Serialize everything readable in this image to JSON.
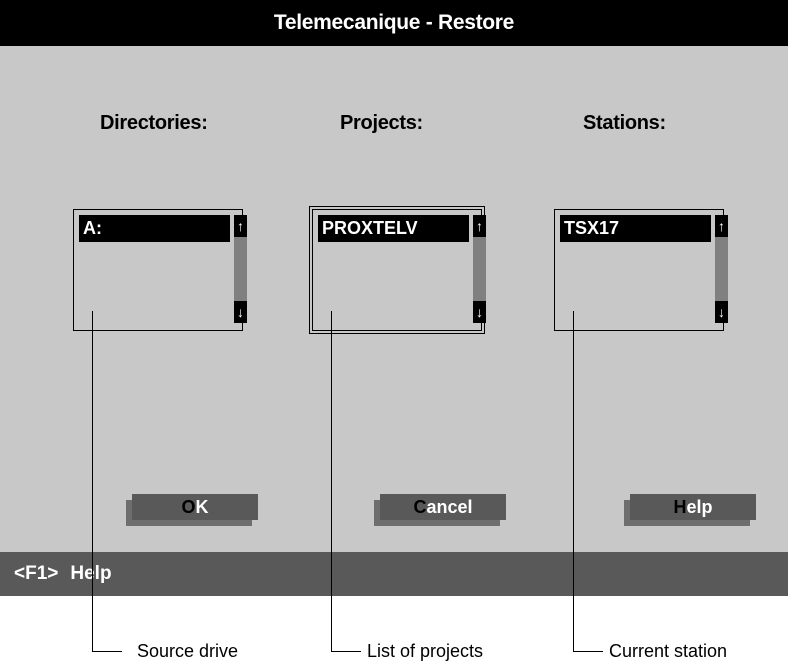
{
  "window": {
    "title": "Telemecanique - Restore"
  },
  "columns": {
    "directories": {
      "label": "Directories:",
      "selected": "A:"
    },
    "projects": {
      "label": "Projects:",
      "selected": "PROXTELV"
    },
    "stations": {
      "label": "Stations:",
      "selected": "TSX17"
    }
  },
  "scroll": {
    "up_glyph": "↑",
    "down_glyph": "↓"
  },
  "buttons": {
    "ok": {
      "accel": "O",
      "rest": "K"
    },
    "cancel": {
      "accel": "C",
      "rest": "ancel"
    },
    "help": {
      "accel": "H",
      "rest": "elp"
    }
  },
  "statusbar": {
    "key": "<F1>",
    "label": "Help"
  },
  "callouts": {
    "source_drive": "Source drive",
    "list_of_projects": "List of projects",
    "current_station": "Current station"
  }
}
